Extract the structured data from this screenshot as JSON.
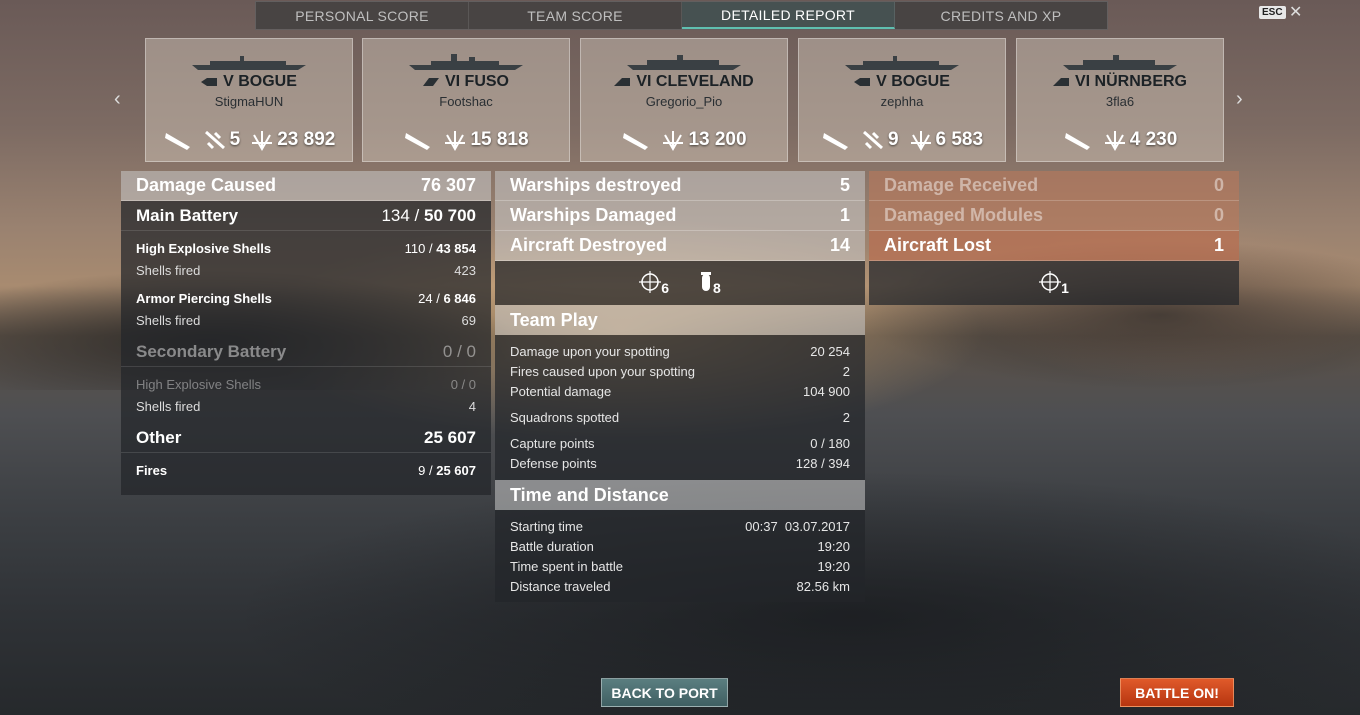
{
  "tabs": [
    "PERSONAL SCORE",
    "TEAM SCORE",
    "DETAILED REPORT",
    "CREDITS AND XP"
  ],
  "esc_label": "ESC",
  "close_glyph": "✕",
  "nav": {
    "prev": "‹",
    "next": "›"
  },
  "ships": [
    {
      "name": "V BOGUE",
      "player": "StigmaHUN",
      "planes": "5",
      "damage": "23 892",
      "class_icon": "aircraft-carrier-icon"
    },
    {
      "name": "VI FUSO",
      "player": "Footshac",
      "planes": "",
      "damage": "15 818",
      "class_icon": "battleship-icon"
    },
    {
      "name": "VI CLEVELAND",
      "player": "Gregorio_Pio",
      "planes": "",
      "damage": "13 200",
      "class_icon": "cruiser-icon"
    },
    {
      "name": "V BOGUE",
      "player": "zephha",
      "planes": "9",
      "damage": "6 583",
      "class_icon": "aircraft-carrier-icon"
    },
    {
      "name": "VI NÜRNBERG",
      "player": "3fla6",
      "planes": "",
      "damage": "4 230",
      "class_icon": "cruiser-icon"
    }
  ],
  "damage": {
    "title": "Damage Caused",
    "total": "76 307",
    "main_battery": {
      "label": "Main Battery",
      "hits": "134 /",
      "value": "50 700"
    },
    "he": {
      "label": "High Explosive Shells",
      "hits": "110 /",
      "value": "43 854",
      "fired_label": "Shells fired",
      "fired": "423"
    },
    "ap": {
      "label": "Armor Piercing Shells",
      "hits": "24 /",
      "value": "6 846",
      "fired_label": "Shells fired",
      "fired": "69"
    },
    "secondary": {
      "label": "Secondary Battery",
      "value": "0 / 0"
    },
    "sec_he": {
      "label": "High Explosive Shells",
      "value": "0 / 0",
      "fired_label": "Shells fired",
      "fired": "4"
    },
    "other": {
      "label": "Other",
      "value": "25 607"
    },
    "fires": {
      "label": "Fires",
      "hits": "9 /",
      "value": "25 607"
    }
  },
  "results": {
    "destroyed": {
      "label": "Warships destroyed",
      "value": "5"
    },
    "damaged": {
      "label": "Warships Damaged",
      "value": "1"
    },
    "aircraft": {
      "label": "Aircraft Destroyed",
      "value": "14"
    },
    "icon_a": "6",
    "icon_b": "8"
  },
  "team_play": {
    "title": "Team Play",
    "rows": [
      {
        "label": "Damage upon your spotting",
        "value": "20 254"
      },
      {
        "label": "Fires caused upon your spotting",
        "value": "2"
      },
      {
        "label": "Potential damage",
        "value": "104 900"
      },
      {
        "label": "Squadrons spotted",
        "value": "2"
      },
      {
        "label": "Capture points",
        "value": "0 / 180"
      },
      {
        "label": "Defense points",
        "value": "128 / 394"
      }
    ]
  },
  "time": {
    "title": "Time and Distance",
    "start_label": "Starting time",
    "start_time": "00:37",
    "start_date": "03.07.2017",
    "duration_label": "Battle duration",
    "duration": "19:20",
    "spent_label": "Time spent in battle",
    "spent": "19:20",
    "distance_label": "Distance traveled",
    "distance": "82.56 km"
  },
  "received": {
    "damage": {
      "label": "Damage Received",
      "value": "0"
    },
    "modules": {
      "label": "Damaged Modules",
      "value": "0"
    },
    "lost": {
      "label": "Aircraft Lost",
      "value": "1"
    },
    "icon_a": "1"
  },
  "buttons": {
    "back": "BACK TO PORT",
    "battle": "BATTLE ON!"
  },
  "colors": {
    "accent": "#5fbfb0",
    "battle": "#d4481c",
    "received": "#be7a5a"
  }
}
